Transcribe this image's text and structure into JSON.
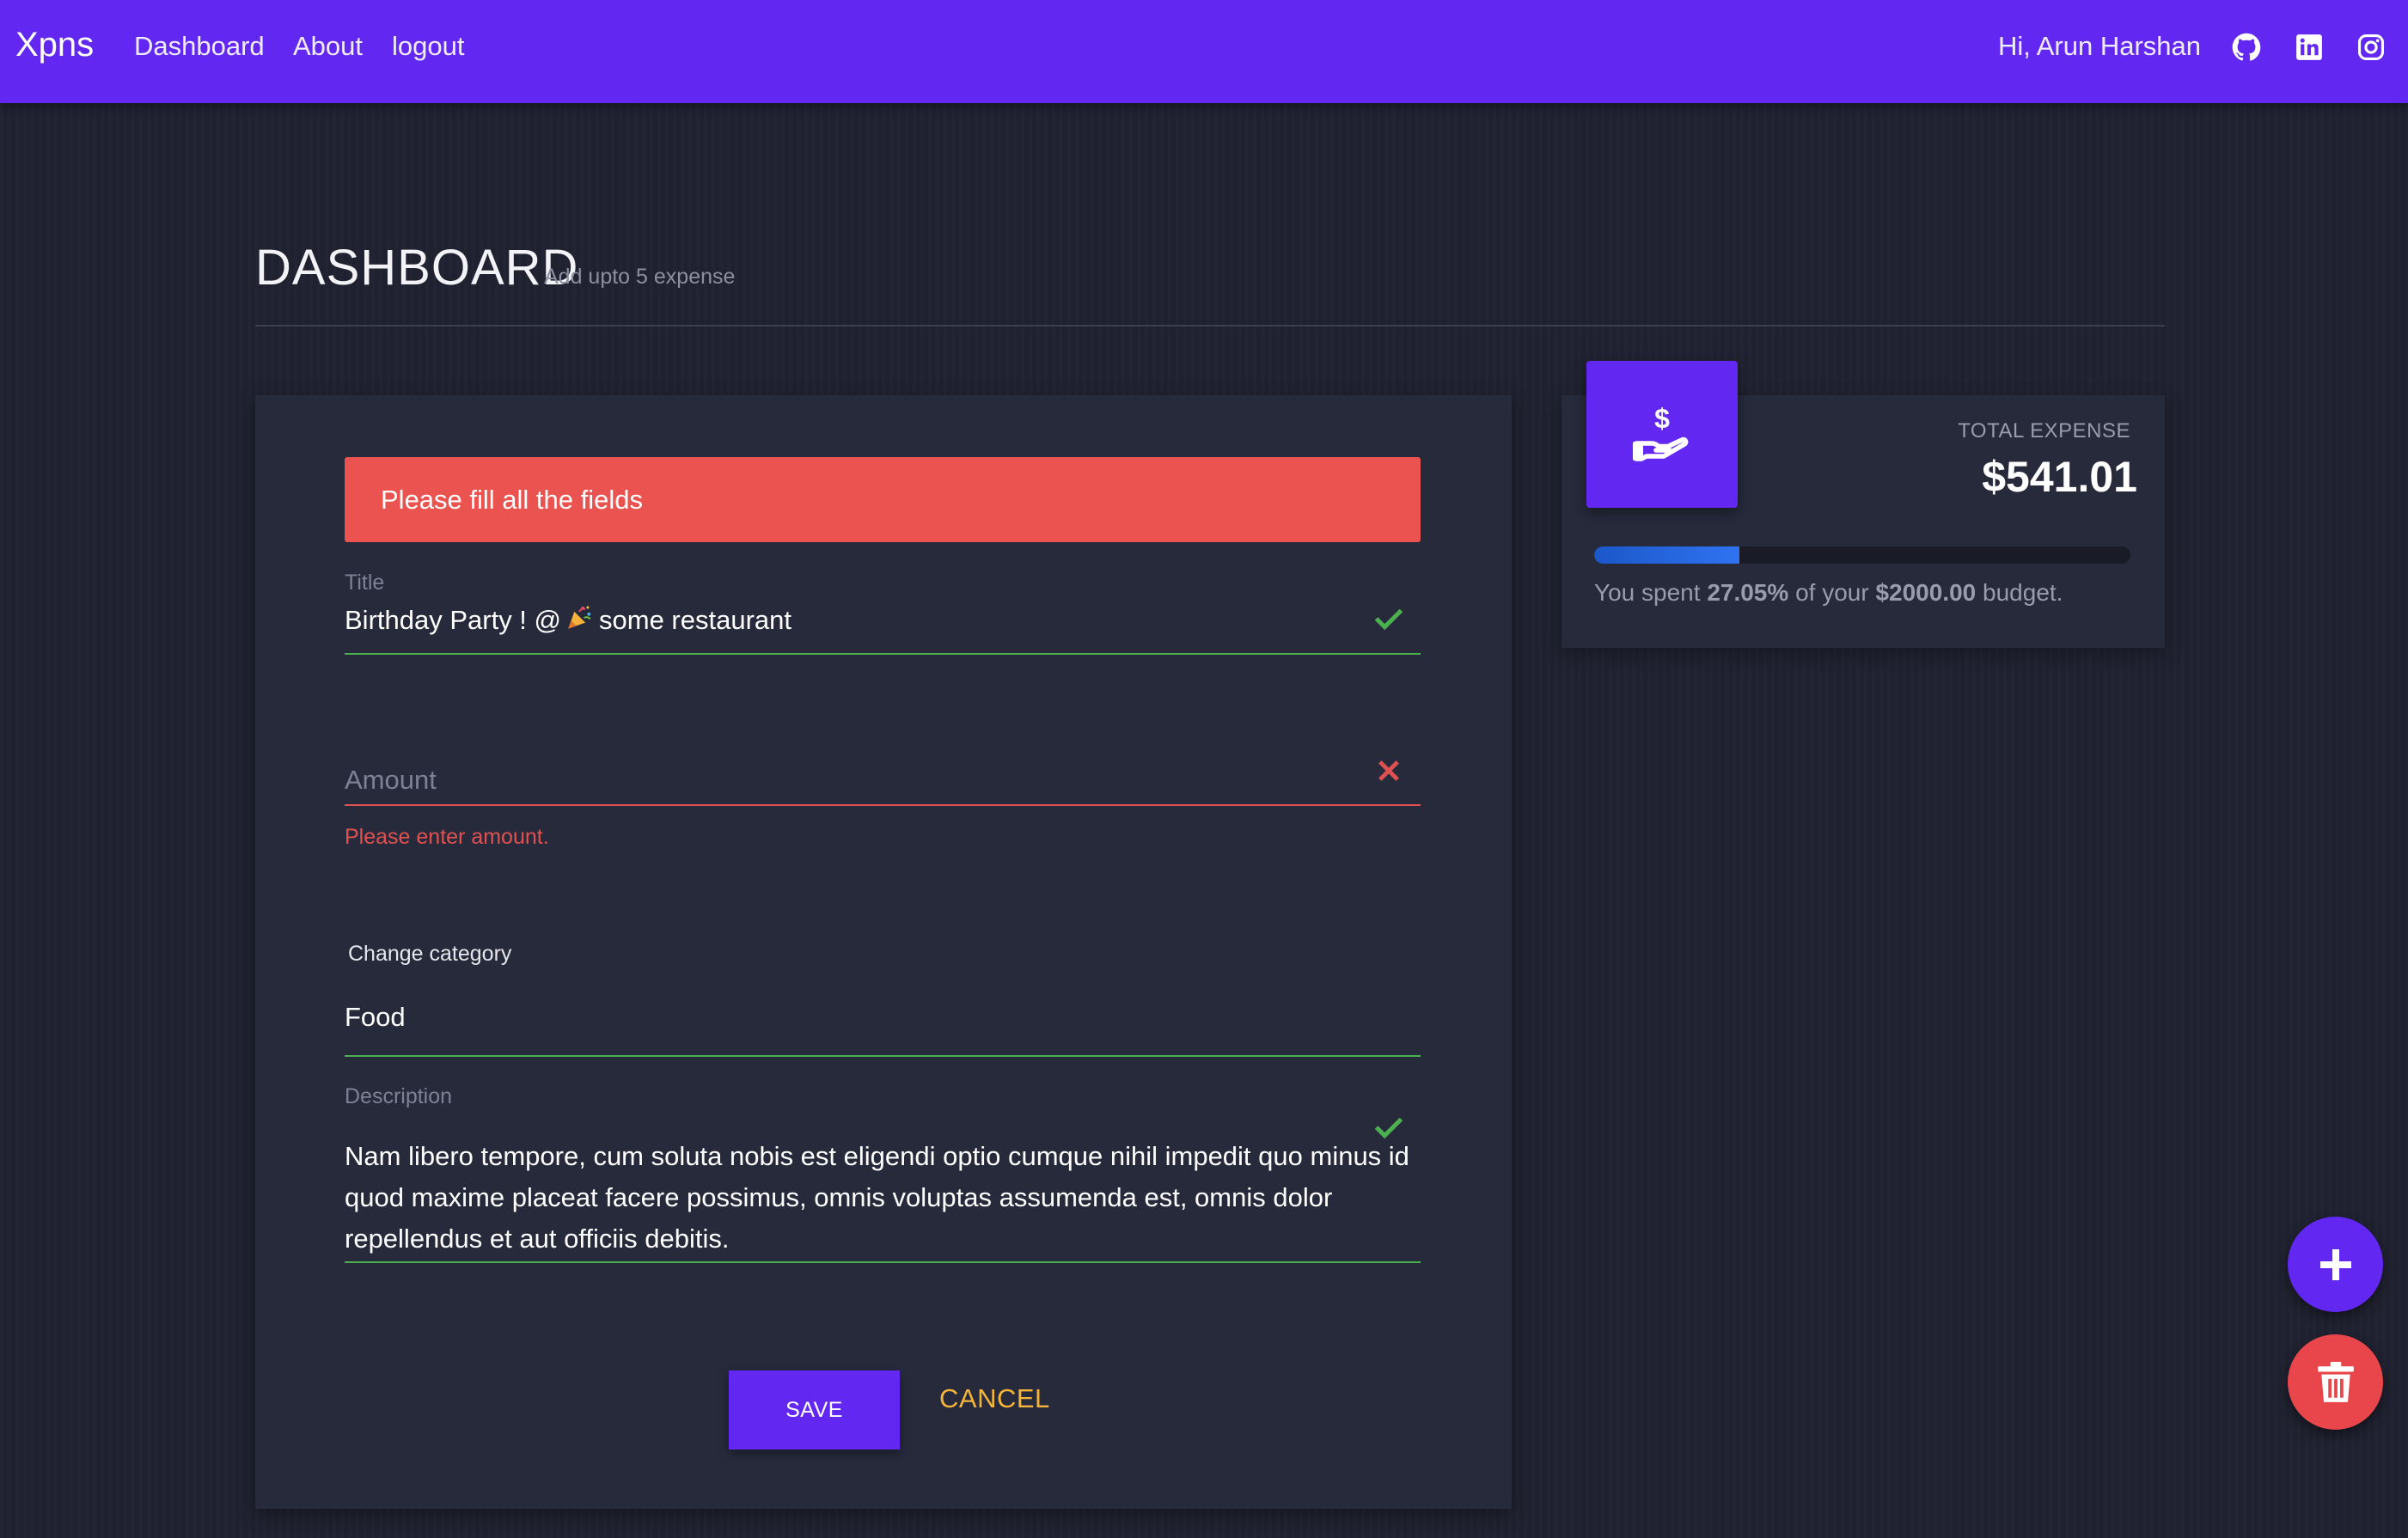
{
  "navbar": {
    "brand": "Xpns",
    "links": [
      "Dashboard",
      "About",
      "logout"
    ],
    "greeting": "Hi, Arun Harshan",
    "social_icons": [
      "github-icon",
      "linkedin-icon",
      "instagram-icon"
    ]
  },
  "header": {
    "title": "DASHBOARD",
    "subtitle": "Add upto 5 expense"
  },
  "form": {
    "alert": "Please fill all the fields",
    "title_label": "Title",
    "title_value_prefix": "Birthday Party ! @",
    "title_value_suffix": "some restaurant",
    "title_emoji": "party-popper-icon",
    "amount_placeholder": "Amount",
    "amount_value": "",
    "amount_error": "Please enter amount.",
    "category_label": "Change category",
    "category_value": "Food",
    "description_label": "Description",
    "description_value": "Nam libero tempore, cum soluta nobis est eligendi optio cumque nihil impedit quo minus id quod maxime placeat facere possimus, omnis voluptas assumenda est, omnis dolor repellendus et aut officiis debitis.",
    "save_label": "SAVE",
    "cancel_label": "CANCEL"
  },
  "expense": {
    "icon": "hand-dollar-icon",
    "total_label": "TOTAL EXPENSE",
    "total_value": "$541.01",
    "progress_percent": 27.05,
    "budget_prefix": "You spent",
    "budget_percent": "27.05%",
    "budget_middle": "of your",
    "budget_amount": "$2000.00",
    "budget_suffix": "budget."
  },
  "fabs": {
    "add_icon": "plus-icon",
    "delete_icon": "trash-icon"
  },
  "colors": {
    "primary": "#6228f2",
    "alert": "#ea534f",
    "success": "#4caf50",
    "error": "#e05252",
    "cancel": "#f5b43a",
    "background": "#1f2130",
    "card": "#272a3b"
  }
}
